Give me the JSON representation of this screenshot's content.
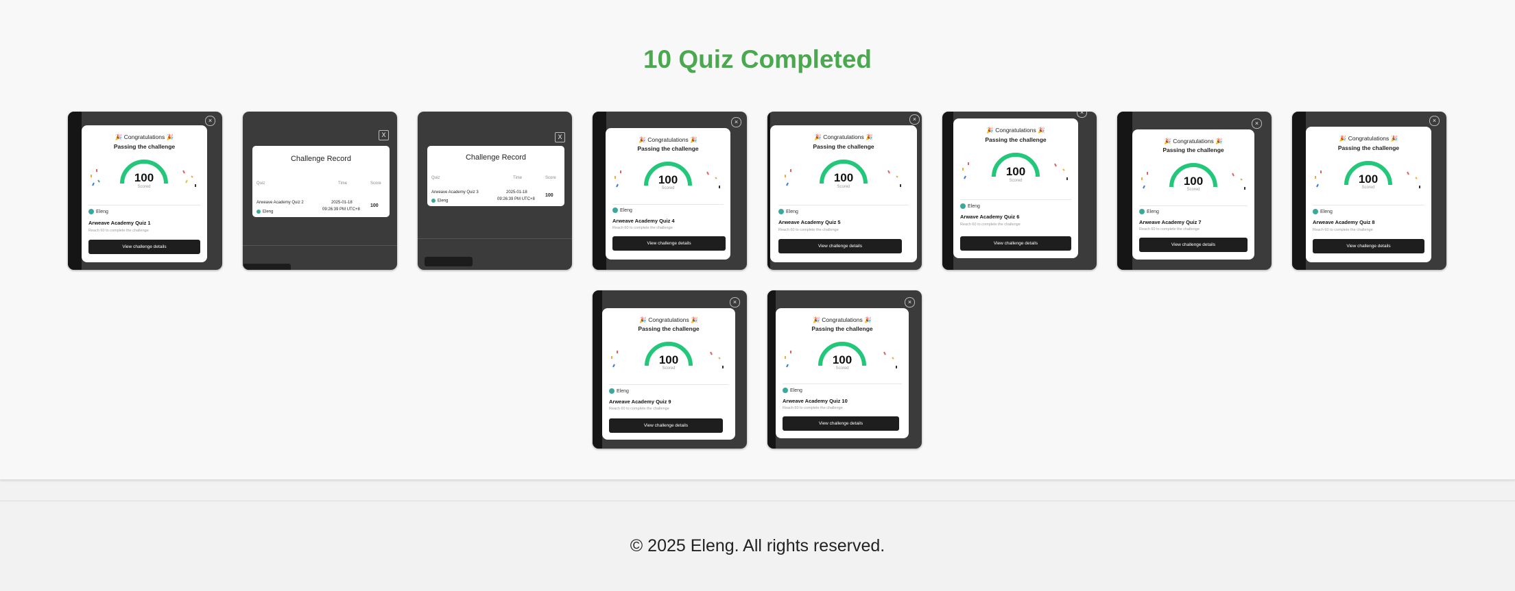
{
  "title": "10 Quiz Completed",
  "footer": "© 2025 Eleng. All rights reserved.",
  "modal": {
    "congrats": "🎉 Congratulations 🎉",
    "passing": "Passing the challenge",
    "score": "100",
    "scored_label": "Scored",
    "user": "Eleng",
    "desc": "Reach 60 to complete the challenge",
    "button": "View challenge details",
    "close": "×"
  },
  "colors": {
    "accent": "#4aa84f",
    "gauge": "#22c77a"
  },
  "quizzes": [
    {
      "name": "Arweave Academy Quiz 1"
    },
    {
      "name": "Arweave Academy Quiz 4"
    },
    {
      "name": "Arweave Academy Quiz 5"
    },
    {
      "name": "Arwave Academy Quiz 6"
    },
    {
      "name": "Arweave Academy Quiz 7"
    },
    {
      "name": "Arweave Academy Quiz 8"
    },
    {
      "name": "Arweave Academy Quiz 9"
    },
    {
      "name": "Arweave Academy Quiz 10"
    }
  ],
  "records": [
    {
      "title": "Challenge Record",
      "col_quiz": "Quiz",
      "col_time": "Time",
      "col_score": "Score",
      "quiz": "Arweave Academy Quiz 2",
      "date": "2025-01-18",
      "time": "09:26:39 PM UTC+8",
      "user": "Eleng",
      "score": "100",
      "close": "X"
    },
    {
      "title": "Challenge Record",
      "col_quiz": "Quiz",
      "col_time": "Time",
      "col_score": "Score",
      "quiz": "Arweave Academy Quiz 3",
      "date": "2025-01-18",
      "time": "09:26:39 PM UTC+8",
      "user": "Eleng",
      "score": "100",
      "close": "X"
    }
  ]
}
